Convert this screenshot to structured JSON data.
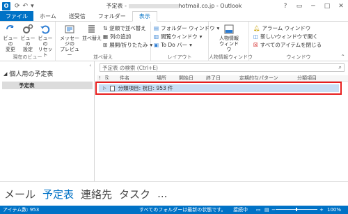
{
  "window": {
    "app_icon": "O",
    "title": "予定表 - ",
    "title_email": "hotmail.co.jp",
    "title_app": " - Outlook",
    "help": "?",
    "restore": "▭",
    "minimize": "─",
    "maximize": "□",
    "close": "✕"
  },
  "tabs": [
    "ファイル",
    "ホーム",
    "送受信",
    "フォルダー",
    "表示"
  ],
  "active_tab": "表示",
  "ribbon": {
    "groups": {
      "current_view": "現在のビュー",
      "arrangement": "並べ替え",
      "layout": "レイアウト",
      "people_pane": "人物情報ウィンドウ",
      "window": "ウィンドウ"
    },
    "change_view": "ビューの\n変更",
    "view_settings": "ビューの\n設定",
    "reset_view": "ビューの\nリセット",
    "message_preview": "メッセージの\nプレビュー",
    "arrange_by": "並べ替え",
    "reverse_sort": "逆順で並べ替え",
    "add_columns": "列の追加",
    "expand_collapse": "展開/折りたたみ",
    "folder_pane": "フォルダー ウィンドウ",
    "reading_pane": "閲覧ウィンドウ",
    "todo_bar": "To Do バー",
    "people_pane": "人物情報\nウィンドウ",
    "reminders": "アラーム ウィンドウ",
    "open_new_window": "新しいウィンドウで開く",
    "close_all_items": "すべてのアイテムを閉じる"
  },
  "left_pane": {
    "section_title": "個人用の予定表",
    "calendar_item": "予定表"
  },
  "main": {
    "search_placeholder": "予定表 の検索 (Ctrl+E)",
    "columns": [
      "件名",
      "場所",
      "開始日",
      "終了日",
      "定期的なパターン",
      "分類項目"
    ],
    "group_row": "分類項目: 祝日: 953 件"
  },
  "nav": [
    "メール",
    "予定表",
    "連絡先",
    "タスク",
    "..."
  ],
  "nav_active": "予定表",
  "status": {
    "item_count": "アイテム数: 953",
    "sync": "すべてのフォルダーは最新の状態です。",
    "connection": "接続中",
    "zoom": "100%",
    "zoom_level": 1.0
  },
  "colors": {
    "accent": "#0072c6",
    "highlight_border": "#e81e1e",
    "group_row_bg": "#c8def4"
  }
}
